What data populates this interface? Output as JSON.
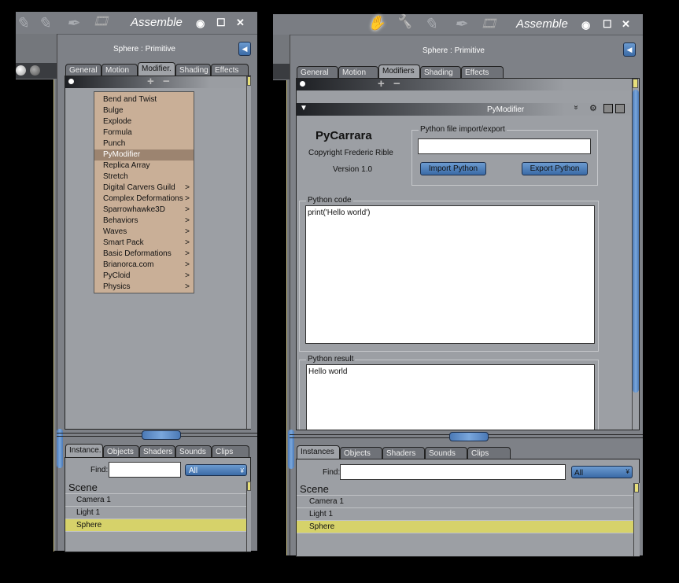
{
  "left": {
    "title": "Assemble",
    "object_label": "Sphere : Primitive",
    "tabs": [
      "General",
      "Motion",
      "Modifier.",
      "Shading",
      "Effects"
    ],
    "menu": [
      {
        "label": "Bend and Twist",
        "sub": false
      },
      {
        "label": "Bulge",
        "sub": false
      },
      {
        "label": "Explode",
        "sub": false
      },
      {
        "label": "Formula",
        "sub": false
      },
      {
        "label": "Punch",
        "sub": false
      },
      {
        "label": "PyModifier",
        "sub": false,
        "selected": true
      },
      {
        "label": "Replica Array",
        "sub": false
      },
      {
        "label": "Stretch",
        "sub": false
      },
      {
        "label": "Digital Carvers Guild",
        "sub": true
      },
      {
        "label": "Complex Deformations",
        "sub": true
      },
      {
        "label": "Sparrowhawke3D",
        "sub": true
      },
      {
        "label": "Behaviors",
        "sub": true
      },
      {
        "label": "Waves",
        "sub": true
      },
      {
        "label": "Smart Pack",
        "sub": true
      },
      {
        "label": "Basic Deformations",
        "sub": true
      },
      {
        "label": "Brianorca.com",
        "sub": true
      },
      {
        "label": "PyCloid",
        "sub": true
      },
      {
        "label": "Physics",
        "sub": true
      }
    ],
    "bottom_tabs": [
      "Instance.",
      "Objects",
      "Shaders",
      "Sounds",
      "Clips"
    ],
    "find_label": "Find:",
    "find_value": "",
    "filter": "All",
    "scene": [
      "Scene",
      "Camera 1",
      "Light 1",
      "Sphere"
    ]
  },
  "right": {
    "title": "Assemble",
    "object_label": "Sphere : Primitive",
    "tabs": [
      "General",
      "Motion",
      "Modifiers",
      "Shading",
      "Effects"
    ],
    "modifier_name": "PyModifier",
    "plugin_name": "PyCarrara",
    "copyright": "Copyright Frederic Rible",
    "version": "Version 1.0",
    "file_group": "Python file import/export",
    "file_value": "",
    "import_btn": "Import Python",
    "export_btn": "Export Python",
    "code_group": "Python code",
    "code": "print('Hello world')",
    "result_group": "Python result",
    "result": "Hello world",
    "bottom_tabs": [
      "Instances",
      "Objects",
      "Shaders",
      "Sounds",
      "Clips"
    ],
    "find_label": "Find:",
    "find_value": "",
    "filter": "All",
    "scene": [
      "Scene",
      "Camera 1",
      "Light 1",
      "Sphere"
    ]
  },
  "icons": {
    "hand": "✋",
    "wrench": "🔧",
    "pencil": "✎",
    "brush": "✒",
    "film": "🎞",
    "eye": "◉",
    "maximize": "☐",
    "close": "✕",
    "plus": "+",
    "minus": "−",
    "arrow_left": "◀",
    "chevron": "»"
  },
  "colors": {
    "panel": "#7e8187",
    "content": "#9c9fa4",
    "menu": "#c9af97",
    "selection": "#d6d26a",
    "accent": "#4b79b6"
  }
}
